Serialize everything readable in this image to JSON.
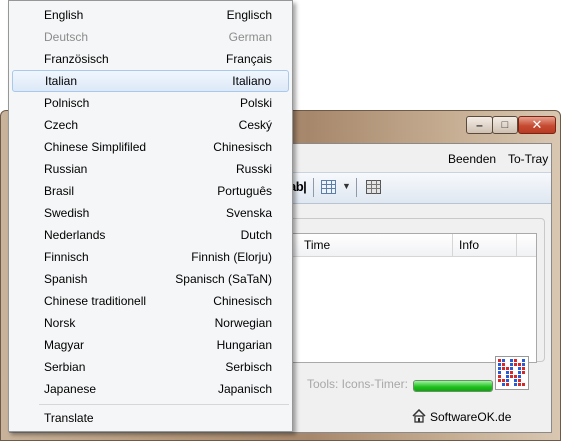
{
  "window": {
    "minimize_glyph": "–",
    "maximize_glyph": "□",
    "close_glyph": "✕",
    "menu": {
      "beenden": "Beenden",
      "to_tray": "To-Tray"
    },
    "toolbar": {
      "ab_label": "ab|"
    },
    "list_columns": [
      "Time",
      "Info"
    ],
    "tools_label": "Tools: Icons-Timer:",
    "timer_progress": 1.0,
    "brand": "SoftwareOK.de"
  },
  "language_menu": {
    "items": [
      {
        "label": "English",
        "native": "Englisch",
        "state": "normal"
      },
      {
        "label": "Deutsch",
        "native": "German",
        "state": "disabled"
      },
      {
        "label": "Französisch",
        "native": "Français",
        "state": "normal"
      },
      {
        "label": "Italian",
        "native": "Italiano",
        "state": "selected"
      },
      {
        "label": "Polnisch",
        "native": "Polski",
        "state": "normal"
      },
      {
        "label": "Czech",
        "native": "Ceský",
        "state": "normal"
      },
      {
        "label": "Chinese Simplifiled",
        "native": "Chinesisch",
        "state": "normal"
      },
      {
        "label": "Russian",
        "native": "Russki",
        "state": "normal"
      },
      {
        "label": "Brasil",
        "native": "Português",
        "state": "normal"
      },
      {
        "label": "Swedish",
        "native": "Svenska",
        "state": "normal"
      },
      {
        "label": "Nederlands",
        "native": "Dutch",
        "state": "normal"
      },
      {
        "label": "Finnisch",
        "native": "Finnish (Elorju)",
        "state": "normal"
      },
      {
        "label": "Spanish",
        "native": "Spanisch (SaTaN)",
        "state": "normal"
      },
      {
        "label": "Chinese traditionell",
        "native": "Chinesisch",
        "state": "normal"
      },
      {
        "label": "Norsk",
        "native": "Norwegian",
        "state": "normal"
      },
      {
        "label": "Magyar",
        "native": "Hungarian",
        "state": "normal"
      },
      {
        "label": "Serbian",
        "native": "Serbisch",
        "state": "normal"
      },
      {
        "label": "Japanese",
        "native": "Japanisch",
        "state": "normal"
      }
    ],
    "translate_label": "Translate"
  }
}
